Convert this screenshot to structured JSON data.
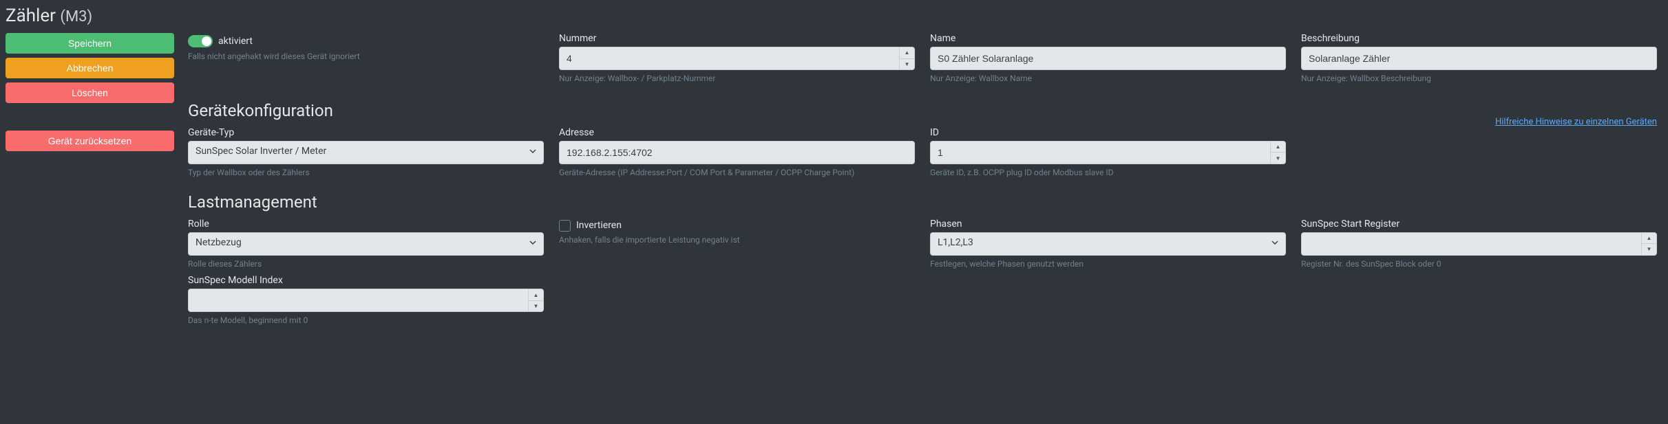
{
  "title": {
    "main": "Zähler",
    "sub": "(M3)"
  },
  "buttons": {
    "save": "Speichern",
    "cancel": "Abbrechen",
    "delete": "Löschen",
    "reset": "Gerät zurücksetzen"
  },
  "activated": {
    "label": "aktiviert",
    "on": true,
    "help": "Falls nicht angehakt wird dieses Gerät ignoriert"
  },
  "basic": {
    "number": {
      "label": "Nummer",
      "value": "4",
      "help": "Nur Anzeige: Wallbox- / Parkplatz-Nummer"
    },
    "name": {
      "label": "Name",
      "value": "S0 Zähler Solaranlage",
      "help": "Nur Anzeige: Wallbox Name"
    },
    "descr": {
      "label": "Beschreibung",
      "value": "Solaranlage Zähler",
      "help": "Nur Anzeige: Wallbox Beschreibung"
    }
  },
  "deviceConfig": {
    "heading": "Gerätekonfiguration",
    "helpLink": "Hilfreiche Hinweise zu einzelnen Geräten",
    "type": {
      "label": "Geräte-Typ",
      "value": "SunSpec Solar Inverter / Meter",
      "help": "Typ der Wallbox oder des Zählers"
    },
    "address": {
      "label": "Adresse",
      "value": "192.168.2.155:4702",
      "help": "Geräte-Adresse (IP Addresse:Port / COM Port & Parameter / OCPP Charge Point)"
    },
    "id": {
      "label": "ID",
      "value": "1",
      "help": "Geräte ID, z.B. OCPP plug ID oder Modbus slave ID"
    }
  },
  "loadMgmt": {
    "heading": "Lastmanagement",
    "role": {
      "label": "Rolle",
      "value": "Netzbezug",
      "help": "Rolle dieses Zählers"
    },
    "invert": {
      "label": "Invertieren",
      "checked": false,
      "help": "Anhaken, falls die importierte Leistung negativ ist"
    },
    "phases": {
      "label": "Phasen",
      "value": "L1,L2,L3",
      "help": "Festlegen, welche Phasen genutzt werden"
    },
    "startReg": {
      "label": "SunSpec Start Register",
      "value": "",
      "help": "Register Nr. des SunSpec Block oder 0"
    },
    "modelIdx": {
      "label": "SunSpec Modell Index",
      "value": "",
      "help": "Das n-te Modell, beginnend mit 0"
    }
  }
}
